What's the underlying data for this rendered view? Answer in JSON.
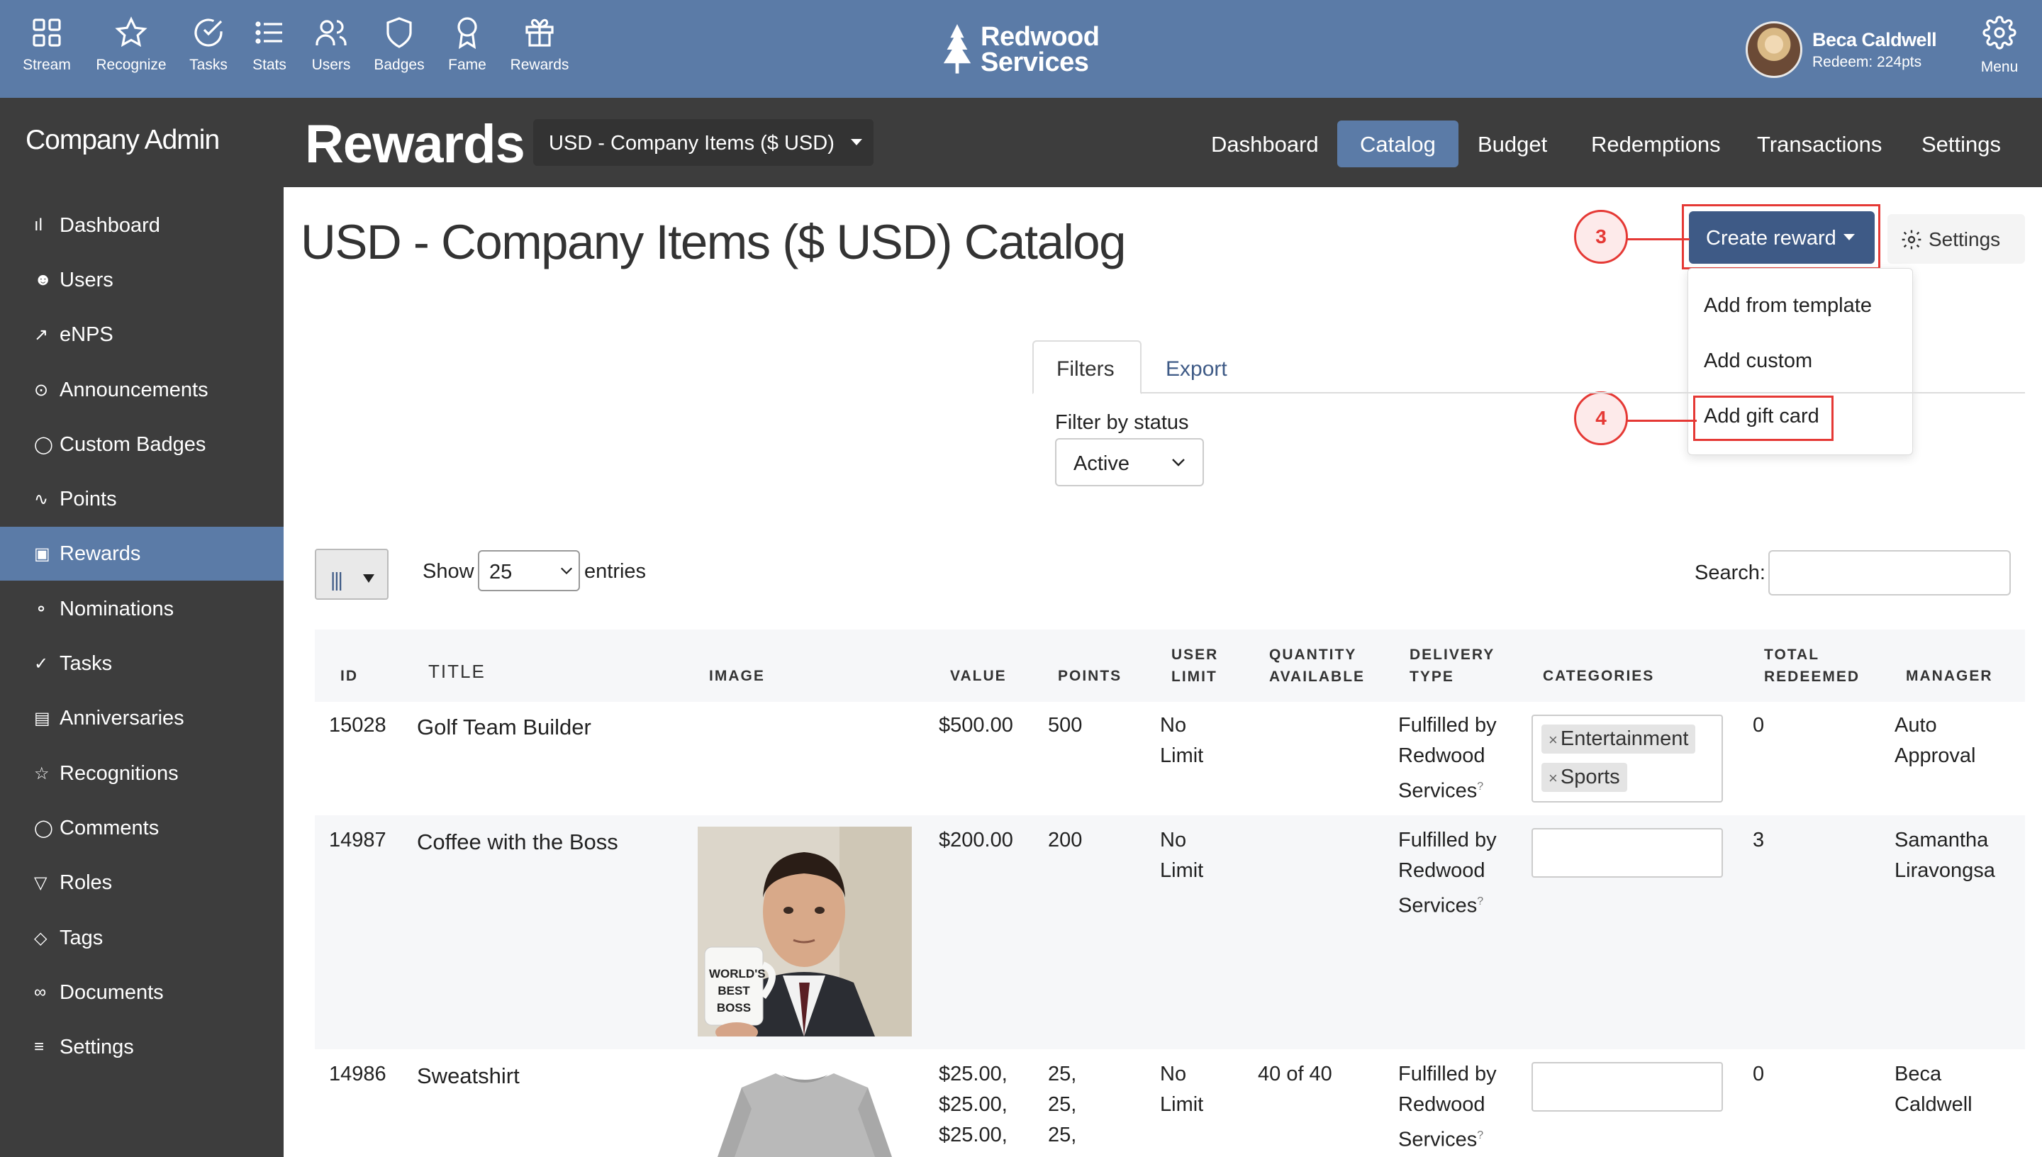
{
  "topnav": {
    "items": [
      {
        "label": "Stream",
        "icon": "grid-icon"
      },
      {
        "label": "Recognize",
        "icon": "star-icon"
      },
      {
        "label": "Tasks",
        "icon": "check-circle-icon"
      },
      {
        "label": "Stats",
        "icon": "list-icon"
      },
      {
        "label": "Users",
        "icon": "users-icon"
      },
      {
        "label": "Badges",
        "icon": "shield-icon"
      },
      {
        "label": "Fame",
        "icon": "award-icon"
      },
      {
        "label": "Rewards",
        "icon": "gift-icon"
      }
    ],
    "brand_line1": "Redwood",
    "brand_line2": "Services",
    "user_name": "Beca Caldwell",
    "user_points": "Redeem: 224pts",
    "menu_label": "Menu"
  },
  "header": {
    "section": "Company Admin",
    "title": "Rewards",
    "catalog_select": "USD - Company Items ($ USD)",
    "tabs": [
      "Dashboard",
      "Catalog",
      "Budget",
      "Redemptions",
      "Transactions",
      "Settings"
    ],
    "active_tab": "Catalog"
  },
  "sidebar": {
    "items": [
      {
        "label": "Dashboard",
        "icon": "bar-chart-icon"
      },
      {
        "label": "Users",
        "icon": "user-icon"
      },
      {
        "label": "eNPS",
        "icon": "trend-icon"
      },
      {
        "label": "Announcements",
        "icon": "broadcast-icon"
      },
      {
        "label": "Custom Badges",
        "icon": "shield-icon"
      },
      {
        "label": "Points",
        "icon": "activity-icon"
      },
      {
        "label": "Rewards",
        "icon": "gift-icon"
      },
      {
        "label": "Nominations",
        "icon": "award-icon"
      },
      {
        "label": "Tasks",
        "icon": "check-circle-icon"
      },
      {
        "label": "Anniversaries",
        "icon": "calendar-icon"
      },
      {
        "label": "Recognitions",
        "icon": "star-icon"
      },
      {
        "label": "Comments",
        "icon": "comment-icon"
      },
      {
        "label": "Roles",
        "icon": "filter-icon"
      },
      {
        "label": "Tags",
        "icon": "tag-icon"
      },
      {
        "label": "Documents",
        "icon": "paperclip-icon"
      },
      {
        "label": "Settings",
        "icon": "sliders-icon"
      }
    ],
    "active": "Rewards"
  },
  "main": {
    "page_title": "USD - Company Items ($ USD) Catalog",
    "create_reward": "Create reward",
    "settings": "Settings",
    "dropdown": [
      "Add from template",
      "Add custom",
      "Add gift card"
    ],
    "callouts": [
      "3",
      "4"
    ],
    "filter_tabs": [
      "Filters",
      "Export"
    ],
    "filter_label": "Filter by status",
    "filter_value": "Active",
    "show_label": "Show",
    "show_value": "25",
    "entries_label": "entries",
    "search_label": "Search:"
  },
  "table": {
    "headers": [
      "ID",
      "TITLE",
      "IMAGE",
      "VALUE",
      "POINTS",
      "USER LIMIT",
      "QUANTITY AVAILABLE",
      "DELIVERY TYPE",
      "CATEGORIES",
      "TOTAL REDEEMED",
      "MANAGER"
    ],
    "rows": [
      {
        "id": "15028",
        "title": "Golf Team Builder",
        "value": "$500.00",
        "points": "500",
        "user_limit": "No Limit",
        "quantity": "",
        "delivery": "Fulfilled by Redwood Services",
        "categories": [
          "Entertainment",
          "Sports"
        ],
        "redeemed": "0",
        "manager": "Auto Approval"
      },
      {
        "id": "14987",
        "title": "Coffee with the Boss",
        "value": "$200.00",
        "points": "200",
        "user_limit": "No Limit",
        "quantity": "",
        "delivery": "Fulfilled by Redwood Services",
        "categories": [],
        "redeemed": "3",
        "manager": "Samantha Liravongsa",
        "image_text": "WORLD'S BEST BOSS"
      },
      {
        "id": "14986",
        "title": "Sweatshirt",
        "value": "$25.00, $25.00, $25.00,",
        "points": "25, 25, 25,",
        "user_limit": "No Limit",
        "quantity": "40 of 40",
        "delivery": "Fulfilled by Redwood Services",
        "categories": [],
        "redeemed": "0",
        "manager": "Beca Caldwell"
      }
    ]
  },
  "colors": {
    "nav": "#5b7ba7",
    "dark": "#3d3d3d",
    "primary": "#3e5a86",
    "annotation": "#e53935"
  }
}
